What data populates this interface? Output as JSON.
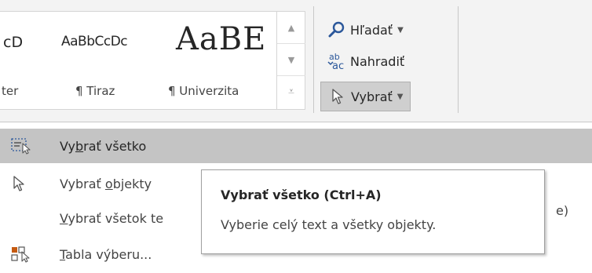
{
  "styles_gallery": {
    "items": [
      {
        "sample": "cD",
        "name": "ter"
      },
      {
        "sample": "AaBbCcDc",
        "name": "¶ Tiraz"
      },
      {
        "sample": "AaBE",
        "name": "¶ Univerzita"
      }
    ],
    "scroll_up_icon": "triangle-up",
    "scroll_down_icon": "triangle-down",
    "more_icon": "more-styles"
  },
  "editing": {
    "find_label": "Hľadať",
    "replace_label": "Nahradiť",
    "select_label": "Vybrať"
  },
  "select_menu": {
    "items": [
      {
        "pre": "Vy",
        "u": "b",
        "post": "rať všetko",
        "icon": "select-all-icon"
      },
      {
        "pre": "Vybrať ",
        "u": "o",
        "post": "bjekty",
        "icon": "cursor-arrow-icon"
      },
      {
        "pre": "",
        "u": "V",
        "post": "ybrať všetok te",
        "icon": ""
      },
      {
        "pre": "",
        "u": "T",
        "post": "abla výberu...",
        "icon": "selection-pane-icon"
      }
    ],
    "hidden_tail": "e)"
  },
  "tooltip": {
    "title": "Vybrať všetko (Ctrl+A)",
    "description": "Vyberie celý text a všetky objekty."
  },
  "colors": {
    "ribbon_bg": "#f3f3f3",
    "hover_bg": "#c4c4c4",
    "accent_blue": "#2b579a"
  }
}
